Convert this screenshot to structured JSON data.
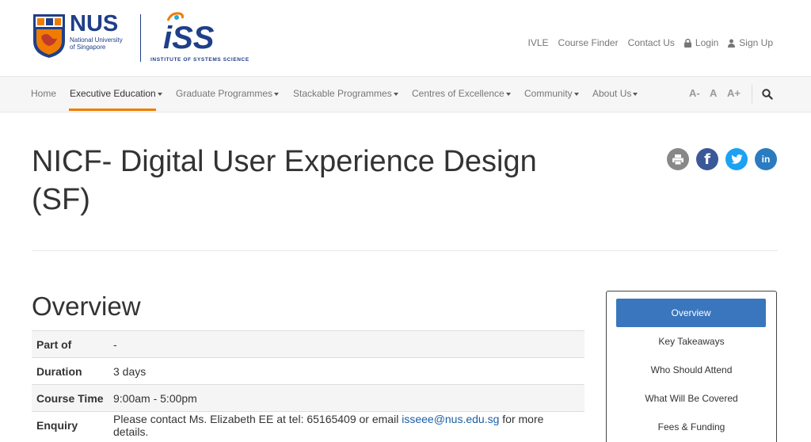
{
  "header": {
    "nus_logo": {
      "word": "NUS",
      "sub1": "National University",
      "sub2": "of Singapore"
    },
    "iss_logo": {
      "word": "iSS",
      "sub": "INSTITUTE OF SYSTEMS SCIENCE"
    },
    "top_links": {
      "ivle": "IVLE",
      "course_finder": "Course Finder",
      "contact_us": "Contact Us",
      "login": "Login",
      "sign_up": "Sign Up"
    }
  },
  "nav": {
    "items": {
      "home": "Home",
      "executive_education": "Executive Education",
      "graduate_programmes": "Graduate Programmes",
      "stackable_programmes": "Stackable Programmes",
      "centres_of_excellence": "Centres of Excellence",
      "community": "Community",
      "about_us": "About Us"
    },
    "active": "Executive Education",
    "font_sizes": {
      "small": "A-",
      "normal": "A",
      "large": "A+"
    }
  },
  "page": {
    "title": "NICF- Digital User Experience Design (SF)",
    "share": {
      "facebook": "f",
      "linkedin": "in"
    }
  },
  "overview": {
    "heading": "Overview",
    "rows": [
      {
        "label": "Part of",
        "value": "-"
      },
      {
        "label": "Duration",
        "value": "3 days"
      },
      {
        "label": "Course Time",
        "value": "9:00am - 5:00pm"
      },
      {
        "label": "Enquiry",
        "value_prefix": "Please contact Ms. Elizabeth EE at tel: 65165409 or email ",
        "email": "isseee@nus.edu.sg",
        "value_suffix": " for more details."
      }
    ]
  },
  "side_nav": {
    "items": [
      "Overview",
      "Key Takeaways",
      "Who Should Attend",
      "What Will Be Covered",
      "Fees & Funding"
    ],
    "active_index": 0
  },
  "colors": {
    "brand_blue": "#1f3f88",
    "accent_orange": "#ef7c00",
    "active_button": "#3a76bd",
    "facebook": "#3b5998",
    "twitter": "#1da1f2",
    "linkedin": "#2a7bbf",
    "print": "#888888"
  }
}
